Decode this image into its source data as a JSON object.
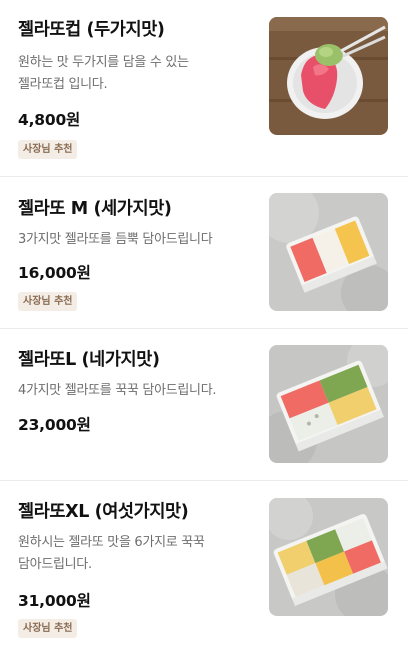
{
  "menu": {
    "items": [
      {
        "name": "젤라또컵 (두가지맛)",
        "description_lines": [
          "원하는 맛 두가지를 담을 수 있는",
          "젤라또컵 입니다."
        ],
        "price": "4,800원",
        "badge": "사장님 추천",
        "image_icon": "gelato-cup-photo"
      },
      {
        "name": "젤라또 M (세가지맛)",
        "description_lines": [
          "3가지맛 젤라또를 듬뿍 담아드립니다"
        ],
        "price": "16,000원",
        "badge": "사장님 추천",
        "image_icon": "gelato-box-m-photo"
      },
      {
        "name": "젤라또L (네가지맛)",
        "description_lines": [
          "4가지맛 젤라또를 꾹꾹 담아드립니다."
        ],
        "price": "23,000원",
        "badge": "",
        "image_icon": "gelato-box-l-photo"
      },
      {
        "name": "젤라또XL (여섯가지맛)",
        "description_lines": [
          "원하시는 젤라또 맛을 6가지로 꾹꾹",
          "담아드립니다."
        ],
        "price": "31,000원",
        "badge": "사장님 추천",
        "image_icon": "gelato-box-xl-photo"
      }
    ]
  }
}
